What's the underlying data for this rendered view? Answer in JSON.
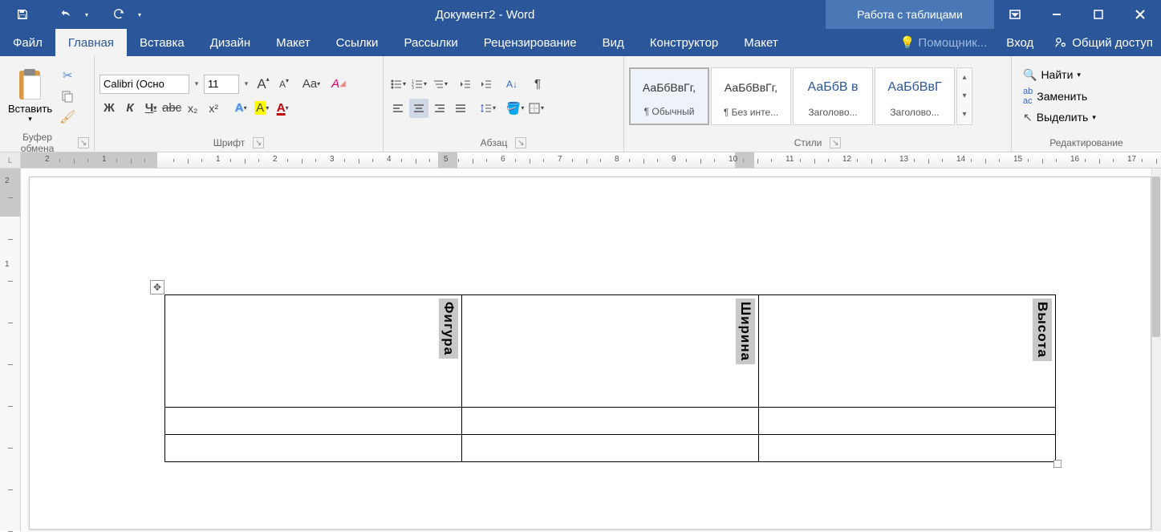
{
  "titlebar": {
    "document_title": "Документ2 - Word",
    "context_title": "Работа с таблицами"
  },
  "tabs": {
    "file": "Файл",
    "home": "Главная",
    "insert": "Вставка",
    "design": "Дизайн",
    "layout": "Макет",
    "references": "Ссылки",
    "mailings": "Рассылки",
    "review": "Рецензирование",
    "view": "Вид",
    "table_design": "Конструктор",
    "table_layout": "Макет",
    "tell_me": "Помощник...",
    "signin": "Вход",
    "share": "Общий доступ"
  },
  "ribbon": {
    "clipboard": {
      "paste": "Вставить",
      "group": "Буфер обмена"
    },
    "font": {
      "group": "Шрифт",
      "name": "Calibri (Осно",
      "size": "11",
      "bold": "Ж",
      "italic": "К",
      "underline": "Ч",
      "strike": "abc",
      "sub": "x₂",
      "sup": "x²",
      "grow": "A",
      "shrink": "A",
      "case": "Aa",
      "clear": "A",
      "effects": "A",
      "highlight": "A",
      "color": "A"
    },
    "paragraph": {
      "group": "Абзац",
      "pilcrow": "¶"
    },
    "styles": {
      "group": "Стили",
      "items": [
        {
          "preview": "АаБбВвГг,",
          "name": "¶ Обычный"
        },
        {
          "preview": "АаБбВвГг,",
          "name": "¶ Без инте..."
        },
        {
          "preview": "АаБбВ в",
          "name": "Заголово..."
        },
        {
          "preview": "АаБбВвГ",
          "name": "Заголово..."
        }
      ]
    },
    "editing": {
      "group": "Редактирование",
      "find": "Найти",
      "replace": "Заменить",
      "select": "Выделить"
    }
  },
  "ruler": {
    "h_values": [
      "2",
      "1",
      "",
      "1",
      "2",
      "3",
      "4",
      "5",
      "6",
      "7",
      "8",
      "9",
      "10",
      "11",
      "12",
      "13",
      "14",
      "15",
      "16",
      "17"
    ],
    "v_values": [
      "2",
      "",
      "1",
      "",
      "",
      "",
      "",
      "",
      ""
    ]
  },
  "table": {
    "cols": [
      370,
      370,
      370
    ],
    "header_row_h": 140,
    "body_row_h": 34,
    "headers": [
      "Фигура",
      "Ширина",
      "Высота"
    ],
    "rows": [
      [
        "",
        "",
        ""
      ],
      [
        "",
        "",
        ""
      ]
    ]
  }
}
